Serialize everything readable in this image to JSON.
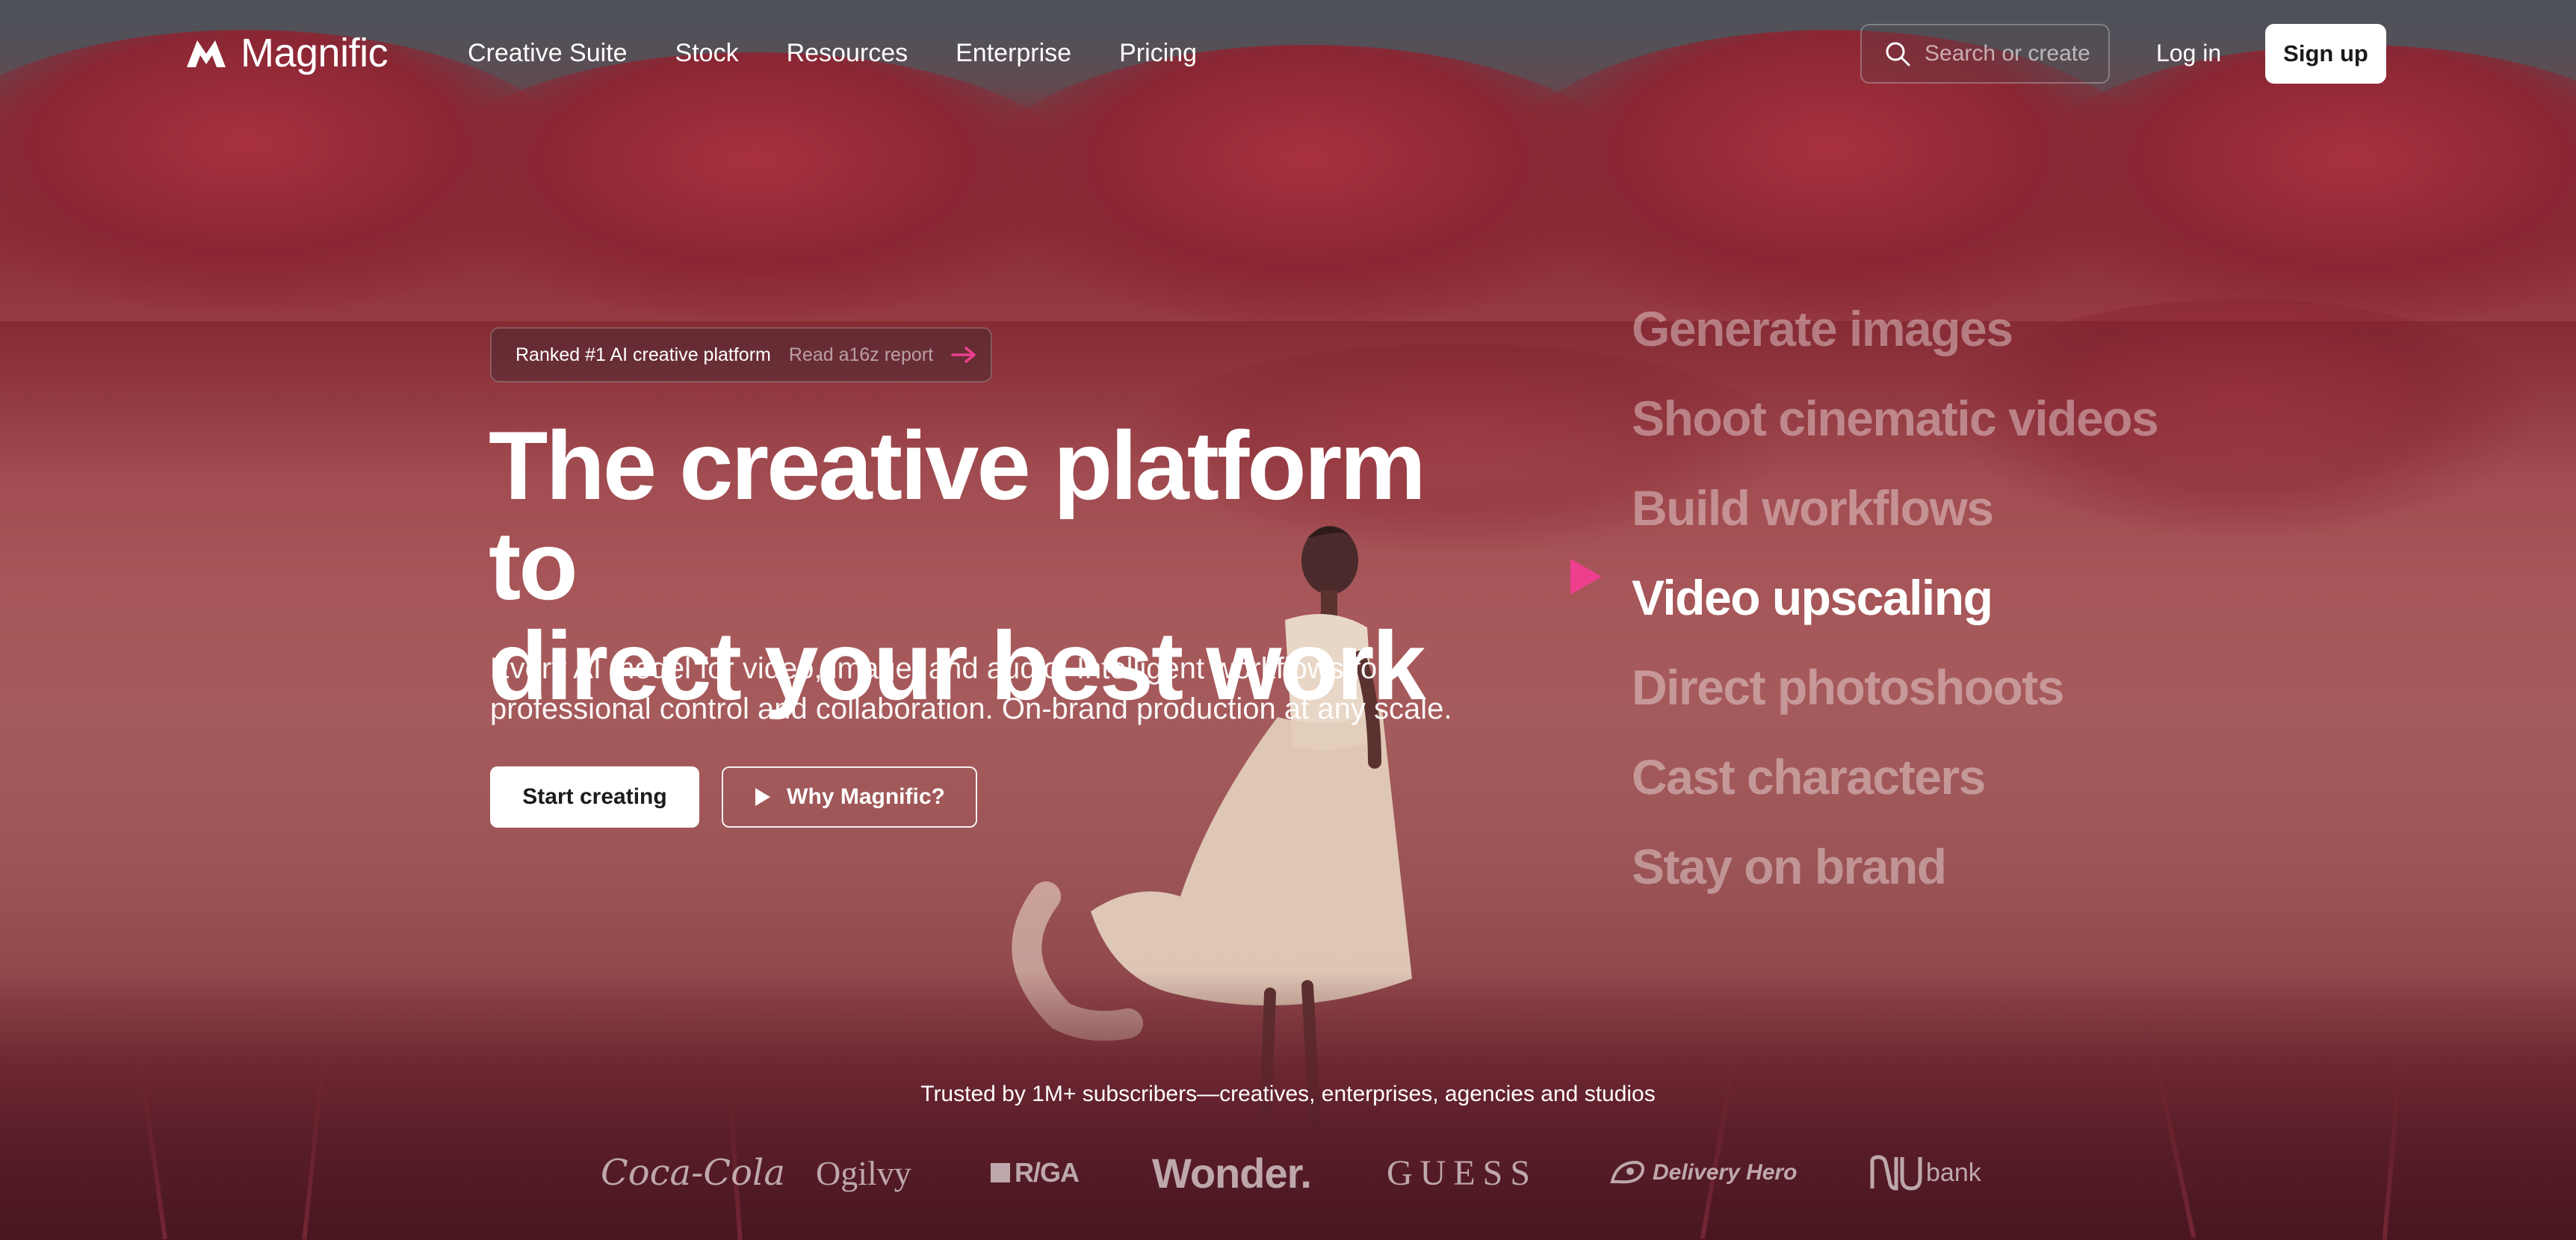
{
  "brand": {
    "name": "Magnific"
  },
  "nav": {
    "links": [
      "Creative Suite",
      "Stock",
      "Resources",
      "Enterprise",
      "Pricing"
    ],
    "search_placeholder": "Search or create",
    "login": "Log in",
    "signup": "Sign up"
  },
  "hero": {
    "badge": "Ranked #1 AI creative platform",
    "badge_link": "Read a16z report",
    "headline_line1": "The creative platform to",
    "headline_line2": "direct your best work",
    "subtitle": "Every AI model for video, image, and audio. Intelligent workflows for professional control and collaboration. On-brand production at any scale.",
    "cta_primary": "Start creating",
    "cta_secondary": "Why Magnific?"
  },
  "features": {
    "items": [
      "Generate images",
      "Shoot cinematic videos",
      "Build workflows",
      "Video upscaling",
      "Direct photoshoots",
      "Cast characters",
      "Stay on brand"
    ],
    "active_index": 3
  },
  "trusted": {
    "text": "Trusted by 1M+ subscribers—creatives, enterprises, agencies and studios",
    "logos": [
      "Coca-Cola",
      "Ogilvy",
      "R/GA",
      "Wonder.",
      "GUESS",
      "Delivery Hero",
      "bank"
    ]
  },
  "colors": {
    "accent": "#ee3f8f",
    "button_bg": "#ffffff",
    "button_text": "#1b1b1d"
  },
  "icons": {
    "logo": "magnific-logo-icon",
    "search": "search-icon",
    "arrow": "arrow-right-icon",
    "play": "play-icon",
    "marker": "play-triangle-icon"
  }
}
